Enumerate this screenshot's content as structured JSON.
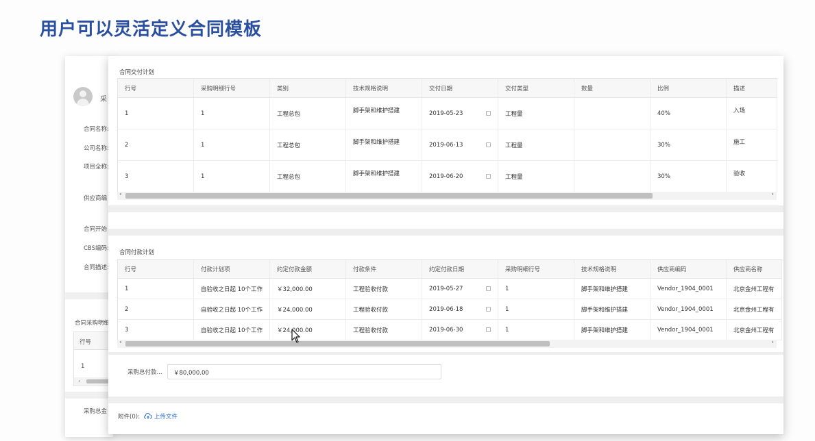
{
  "slide": {
    "title": "用户可以灵活定义合同模板"
  },
  "background_form": {
    "user_name": "采",
    "labels": [
      "合同名称:",
      "公司名称:",
      "项目全称:",
      "供应商编",
      "合同开始",
      "CBS编码:",
      "合同描述:",
      "合同采购明细",
      "采购总金"
    ],
    "mini_table": {
      "header": "行号",
      "cell": "1",
      "scroll_left": "‹"
    }
  },
  "delivery_plan": {
    "title": "合同交付计划",
    "columns": [
      "行号",
      "采购明细行号",
      "类别",
      "技术规格说明",
      "交付日期",
      "交付类型",
      "数量",
      "比例",
      "描述"
    ],
    "rows": [
      [
        "1",
        "1",
        "工程总包",
        "脚手架和维护搭建",
        "2019-05-23",
        "工程量",
        "",
        "40%",
        "入场"
      ],
      [
        "2",
        "1",
        "工程总包",
        "脚手架和维护搭建",
        "2019-06-13",
        "工程量",
        "",
        "30%",
        "施工"
      ],
      [
        "3",
        "1",
        "工程总包",
        "脚手架和维护搭建",
        "2019-06-20",
        "工程量",
        "",
        "30%",
        "验收"
      ]
    ],
    "scroll": {
      "left": "‹",
      "right": "›"
    }
  },
  "payment_plan": {
    "title": "合同付款计划",
    "columns": [
      "行号",
      "付款计划项",
      "约定付款金额",
      "付款条件",
      "约定付款日期",
      "采购明细行号",
      "技术规格说明",
      "供应商编码",
      "供应商名称"
    ],
    "rows": [
      [
        "1",
        "自验收之日起 10个工作",
        "￥32,000.00",
        "工程验收付款",
        "2019-05-27",
        "1",
        "脚手架和维护搭建",
        "Vendor_1904_0001",
        "北京金州工程有"
      ],
      [
        "2",
        "自验收之日起 10个工作",
        "￥24,000.00",
        "工程验收付款",
        "2019-06-18",
        "1",
        "脚手架和维护搭建",
        "Vendor_1904_0001",
        "北京金州工程有"
      ],
      [
        "3",
        "自验收之日起 10个工作",
        "￥24,000.00",
        "工程验收付款",
        "2019-06-30",
        "1",
        "脚手架和维护搭建",
        "Vendor_1904_0001",
        "北京金州工程有"
      ]
    ],
    "scroll": {
      "left": "‹",
      "right": "›"
    }
  },
  "total": {
    "label": "采购总付款...",
    "value": "￥80,000.00"
  },
  "attachments": {
    "label": "附件(0):",
    "upload_label": "上传文件"
  },
  "colors": {
    "title": "#2a4fa0",
    "link": "#2a6fd6"
  },
  "scrollbars": {
    "delivery_visible_fraction": 0.82,
    "payment_visible_fraction": 0.66
  }
}
